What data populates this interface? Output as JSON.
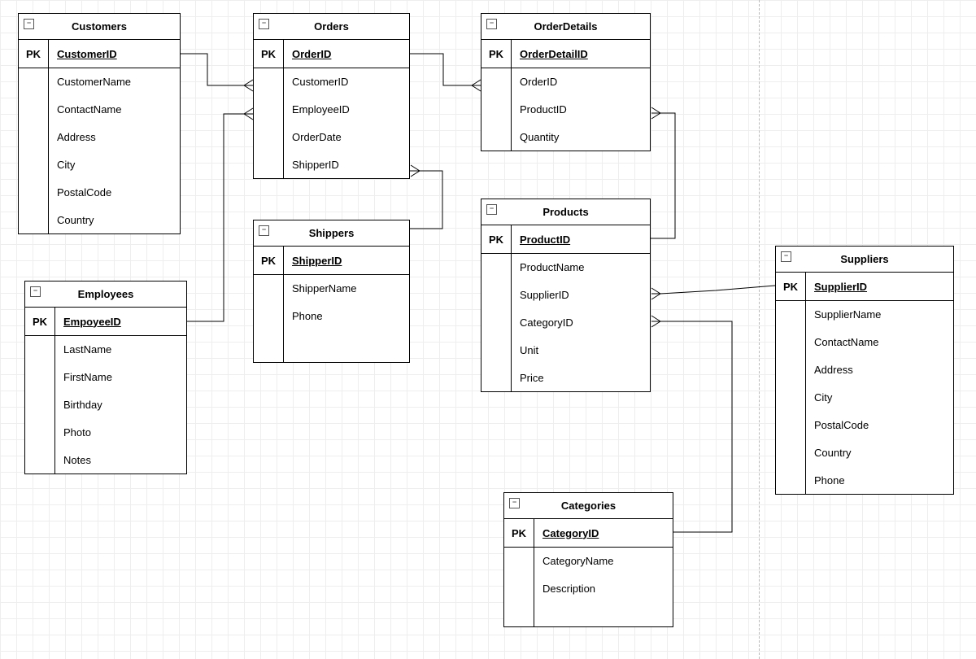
{
  "entities": {
    "customers": {
      "title": "Customers",
      "pk": "CustomerID",
      "fields": [
        "CustomerName",
        "ContactName",
        "Address",
        "City",
        "PostalCode",
        "Country"
      ]
    },
    "orders": {
      "title": "Orders",
      "pk": "OrderID",
      "fields": [
        "CustomerID",
        "EmployeeID",
        "OrderDate",
        "ShipperID"
      ]
    },
    "orderdetails": {
      "title": "OrderDetails",
      "pk": "OrderDetailID",
      "fields": [
        "OrderID",
        "ProductID",
        "Quantity"
      ]
    },
    "employees": {
      "title": "Employees",
      "pk": "EmpoyeeID",
      "fields": [
        "LastName",
        "FirstName",
        "Birthday",
        "Photo",
        "Notes"
      ]
    },
    "shippers": {
      "title": "Shippers",
      "pk": "ShipperID",
      "fields": [
        "ShipperName",
        "Phone"
      ]
    },
    "products": {
      "title": "Products",
      "pk": "ProductID",
      "fields": [
        "ProductName",
        "SupplierID",
        "CategoryID",
        "Unit",
        "Price"
      ]
    },
    "categories": {
      "title": "Categories",
      "pk": "CategoryID",
      "fields": [
        "CategoryName",
        "Description"
      ]
    },
    "suppliers": {
      "title": "Suppliers",
      "pk": "SupplierID",
      "fields": [
        "SupplierName",
        "ContactName",
        "Address",
        "City",
        "PostalCode",
        "Country",
        "Phone"
      ]
    }
  },
  "pk_label": "PK"
}
